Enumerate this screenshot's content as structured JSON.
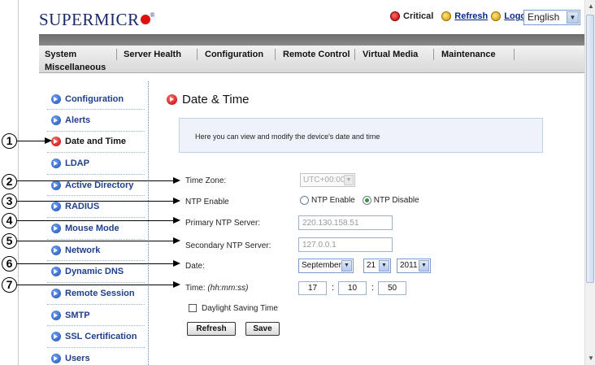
{
  "header": {
    "logo": "SUPERMICR",
    "logo_mark": "®",
    "critical_label": "Critical",
    "refresh_label": "Refresh",
    "logout_label": "Logout",
    "language": "English"
  },
  "nav": {
    "items": [
      "System",
      "Server Health",
      "Configuration",
      "Remote Control",
      "Virtual Media",
      "Maintenance",
      "Miscellaneous"
    ]
  },
  "sidebar": {
    "items": [
      "Configuration",
      "Alerts",
      "Date and Time",
      "LDAP",
      "Active Directory",
      "RADIUS",
      "Mouse Mode",
      "Network",
      "Dynamic DNS",
      "Remote Session",
      "SMTP",
      "SSL Certification",
      "Users"
    ],
    "active": "Date and Time"
  },
  "main": {
    "title": "Date & Time",
    "info": "Here you can view and modify the device's date and time"
  },
  "form": {
    "time_zone_label": "Time Zone:",
    "time_zone_value": "UTC+00:00",
    "ntp_enable_label": "NTP Enable",
    "ntp_enable_option": "NTP Enable",
    "ntp_disable_option": "NTP Disable",
    "primary_ntp_label": "Primary NTP Server:",
    "primary_ntp_value": "220.130.158.51",
    "secondary_ntp_label": "Secondary NTP Server:",
    "secondary_ntp_value": "127.0.0.1",
    "date_label": "Date:",
    "month": "September",
    "day": "21",
    "year": "2011",
    "time_label": "Time:",
    "time_format": "(hh:mm:ss)",
    "hours": "17",
    "minutes": "10",
    "seconds": "50",
    "daylight_label": "Daylight Saving Time",
    "refresh_button": "Refresh",
    "save_button": "Save"
  },
  "callouts": [
    "1",
    "2",
    "3",
    "4",
    "5",
    "6",
    "7"
  ],
  "colors": {
    "brand_blue": "#1a2a6c",
    "link_blue": "#1e3f8a",
    "active_red": "#c00000",
    "nav_dark": "#6c6c6c"
  }
}
